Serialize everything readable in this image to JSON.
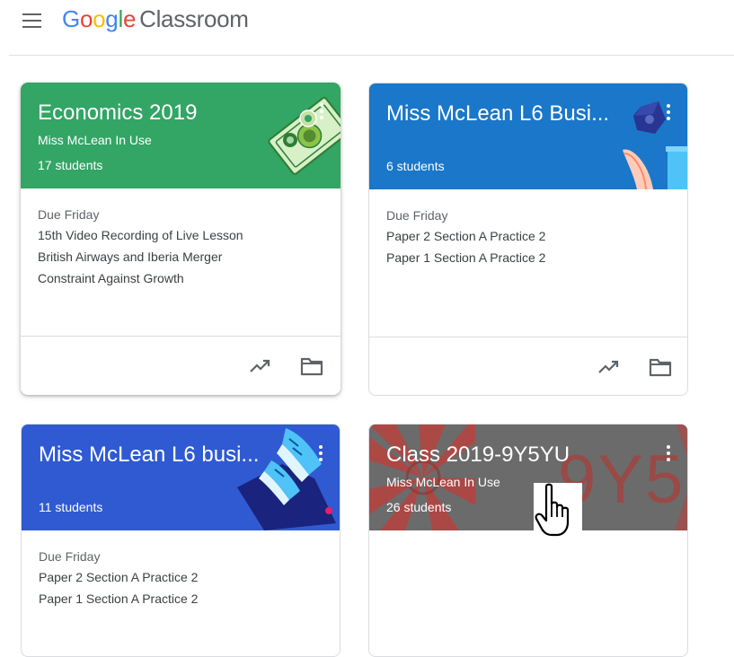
{
  "app": {
    "logo_letters": [
      "G",
      "o",
      "o",
      "g",
      "l",
      "e"
    ],
    "product": "Classroom"
  },
  "colors": {
    "economics": "#33A565",
    "business_a": "#1A77C9",
    "business_b": "#2F5AD2",
    "class_2019": "#6B6B6B"
  },
  "cards": [
    {
      "title": "Economics 2019",
      "subtitle": "Miss McLean In Use",
      "students": "17 students",
      "due": "Due Friday",
      "work": [
        "15th Video Recording of Live Lesson",
        "British Airways and Iberia Merger",
        "Constraint Against Growth"
      ],
      "illustration": "money-illustration"
    },
    {
      "title": "Miss McLean L6 Busi...",
      "subtitle": "",
      "students": "6 students",
      "due": "Due Friday",
      "work": [
        "Paper 2 Section A Practice 2",
        "Paper 1 Section A Practice 2"
      ],
      "illustration": "desk-illustration"
    },
    {
      "title": "Miss McLean L6 busi...",
      "subtitle": "",
      "students": "11 students",
      "due": "Due Friday",
      "work": [
        "Paper 2 Section A Practice 2",
        "Paper 1 Section A Practice 2"
      ],
      "illustration": "sneakers-illustration"
    },
    {
      "title": "Class 2019-9Y5YU",
      "subtitle": "Miss McLean In Use",
      "students": "26 students",
      "banner_text": "9Y5",
      "illustration": "swirl-pattern"
    }
  ],
  "icons": {
    "menu": "hamburger-menu-icon",
    "more": "more-vert-icon",
    "trend": "trending-up-icon",
    "folder": "folder-icon",
    "cursor": "hand-pointer-cursor"
  }
}
